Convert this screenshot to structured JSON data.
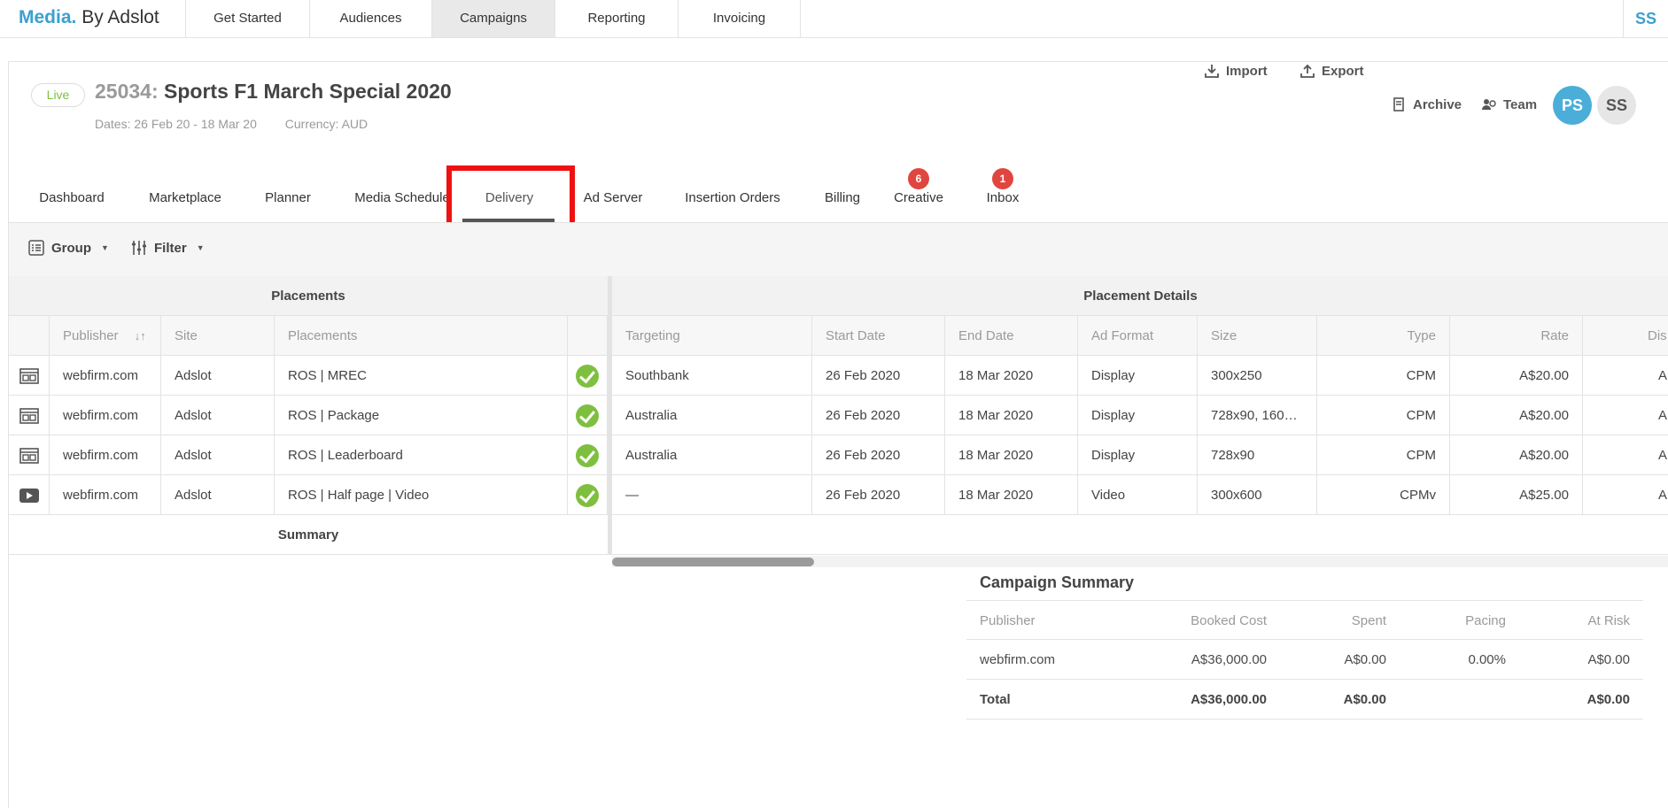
{
  "brand": {
    "media": "Media.",
    "by": "By Adslot"
  },
  "topnav": {
    "tabs": [
      "Get Started",
      "Audiences",
      "Campaigns",
      "Reporting",
      "Invoicing"
    ],
    "active": "Campaigns",
    "user": "SS"
  },
  "campaign": {
    "status": "Live",
    "id": "25034:",
    "name": "Sports F1 March Special 2020",
    "dates": "Dates: 26 Feb 20  -  18 Mar 20",
    "currency": "Currency: AUD"
  },
  "actions": {
    "import": "Import",
    "export": "Export",
    "archive": "Archive",
    "team": "Team"
  },
  "avatars": {
    "ps": "PS",
    "ss": "SS"
  },
  "subtabs": {
    "dashboard": "Dashboard",
    "marketplace": "Marketplace",
    "planner": "Planner",
    "media_schedule": "Media Schedule",
    "delivery": "Delivery",
    "ad_server": "Ad Server",
    "insertion_orders": "Insertion Orders",
    "billing": "Billing",
    "creative": "Creative",
    "creative_count": "6",
    "inbox": "Inbox",
    "inbox_count": "1"
  },
  "toolbar": {
    "group": "Group",
    "filter": "Filter"
  },
  "grid": {
    "placements_header": "Placements",
    "details_header": "Placement Details",
    "columns": {
      "publisher": "Publisher",
      "site": "Site",
      "placements": "Placements",
      "targeting": "Targeting",
      "start_date": "Start Date",
      "end_date": "End Date",
      "ad_format": "Ad Format",
      "size": "Size",
      "type": "Type",
      "rate": "Rate",
      "dis": "Dis"
    },
    "rows": [
      {
        "publisher": "webfirm.com",
        "site": "Adslot",
        "placement": "ROS | MREC",
        "targeting": "Southbank",
        "start": "26 Feb 2020",
        "end": "18 Mar 2020",
        "format": "Display",
        "size": "300x250",
        "type": "CPM",
        "rate": "A$20.00",
        "dis": "A"
      },
      {
        "publisher": "webfirm.com",
        "site": "Adslot",
        "placement": "ROS | Package",
        "targeting": "Australia",
        "start": "26 Feb 2020",
        "end": "18 Mar 2020",
        "format": "Display",
        "size": "728x90, 160x…",
        "type": "CPM",
        "rate": "A$20.00",
        "dis": "A"
      },
      {
        "publisher": "webfirm.com",
        "site": "Adslot",
        "placement": "ROS | Leaderboard",
        "targeting": "Australia",
        "start": "26 Feb 2020",
        "end": "18 Mar 2020",
        "format": "Display",
        "size": "728x90",
        "type": "CPM",
        "rate": "A$20.00",
        "dis": "A"
      },
      {
        "publisher": "webfirm.com",
        "site": "Adslot",
        "placement": "ROS | Half page | Video",
        "targeting": "—",
        "start": "26 Feb 2020",
        "end": "18 Mar 2020",
        "format": "Video",
        "size": "300x600",
        "type": "CPMv",
        "rate": "A$25.00",
        "dis": "A"
      }
    ],
    "row_icons": [
      "display-placement-icon",
      "display-placement-icon",
      "display-placement-icon",
      "video-placement-icon"
    ],
    "summary_label": "Summary"
  },
  "campaign_summary": {
    "title": "Campaign Summary",
    "headers": {
      "publisher": "Publisher",
      "booked": "Booked Cost",
      "spent": "Spent",
      "pacing": "Pacing",
      "risk": "At Risk"
    },
    "row": {
      "publisher": "webfirm.com",
      "booked": "A$36,000.00",
      "spent": "A$0.00",
      "pacing": "0.00%",
      "risk": "A$0.00"
    },
    "total": {
      "label": "Total",
      "booked": "A$36,000.00",
      "spent": "A$0.00",
      "risk": "A$0.00"
    }
  },
  "colors": {
    "accent": "#3aa0d0",
    "live": "#7fbf3f",
    "badge": "#e0463f",
    "highlight": "#ee1111"
  }
}
